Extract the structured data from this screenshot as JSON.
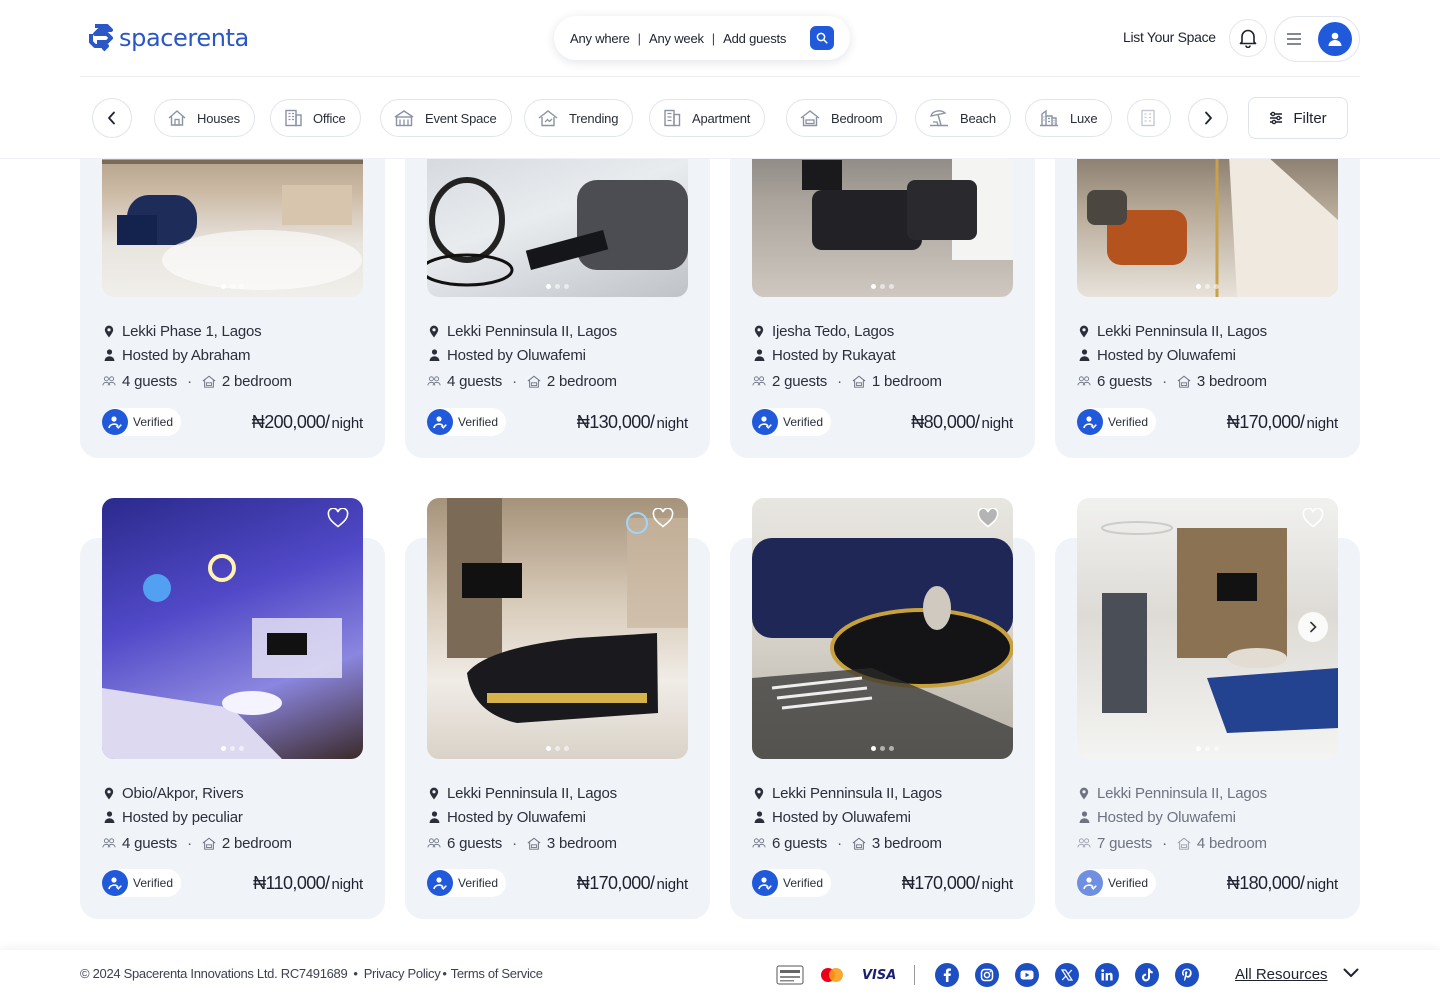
{
  "brand": {
    "name": "spacerenta",
    "color": "#2a56c6"
  },
  "search": {
    "where": "Any where",
    "when": "Any week",
    "who": "Add guests",
    "separator": "|"
  },
  "header": {
    "list_space": "List Your Space"
  },
  "categories": [
    {
      "label": "Houses",
      "icon": "house-icon"
    },
    {
      "label": "Office",
      "icon": "office-icon"
    },
    {
      "label": "Event Space",
      "icon": "event-space-icon"
    },
    {
      "label": "Trending",
      "icon": "trending-icon"
    },
    {
      "label": "Apartment",
      "icon": "apartment-icon"
    },
    {
      "label": "Bedroom",
      "icon": "bedroom-icon"
    },
    {
      "label": "Beach",
      "icon": "beach-icon"
    },
    {
      "label": "Luxe",
      "icon": "luxe-icon"
    }
  ],
  "filter": {
    "label": "Filter"
  },
  "listings": [
    {
      "location": "Lekki Phase 1, Lagos",
      "host": "Hosted by Abraham",
      "guests": "4 guests",
      "bedrooms": "2 bedroom",
      "verified": "Verified",
      "price": "₦200,000/",
      "unit": "night"
    },
    {
      "location": "Lekki Penninsula II, Lagos",
      "host": "Hosted by Oluwafemi",
      "guests": "4 guests",
      "bedrooms": "2 bedroom",
      "verified": "Verified",
      "price": "₦130,000/",
      "unit": "night"
    },
    {
      "location": "Ijesha Tedo, Lagos",
      "host": "Hosted by Rukayat",
      "guests": "2 guests",
      "bedrooms": "1 bedroom",
      "verified": "Verified",
      "price": "₦80,000/",
      "unit": "night"
    },
    {
      "location": "Lekki Penninsula II, Lagos",
      "host": "Hosted by Oluwafemi",
      "guests": "6 guests",
      "bedrooms": "3 bedroom",
      "verified": "Verified",
      "price": "₦170,000/",
      "unit": "night"
    },
    {
      "location": "Obio/Akpor, Rivers",
      "host": "Hosted by peculiar",
      "guests": "4 guests",
      "bedrooms": "2 bedroom",
      "verified": "Verified",
      "price": "₦110,000/",
      "unit": "night"
    },
    {
      "location": "Lekki Penninsula II, Lagos",
      "host": "Hosted by Oluwafemi",
      "guests": "6 guests",
      "bedrooms": "3 bedroom",
      "verified": "Verified",
      "price": "₦170,000/",
      "unit": "night"
    },
    {
      "location": "Lekki Penninsula II, Lagos",
      "host": "Hosted by Oluwafemi",
      "guests": "6 guests",
      "bedrooms": "3 bedroom",
      "verified": "Verified",
      "price": "₦170,000/",
      "unit": "night"
    },
    {
      "location": "Lekki Penninsula II, Lagos",
      "host": "Hosted by Oluwafemi",
      "guests": "7 guests",
      "bedrooms": "4 bedroom",
      "verified": "Verified",
      "price": "₦180,000/",
      "unit": "night"
    }
  ],
  "footer": {
    "copyright": "© 2024 Spacerenta Innovations Ltd. RC7491689",
    "bullet": "•",
    "privacy": "Privacy Policy",
    "terms": "Terms of Service",
    "visa": "VISA",
    "all_resources": "All Resources",
    "social": [
      "facebook-icon",
      "instagram-icon",
      "youtube-icon",
      "x-icon",
      "linkedin-icon",
      "tiktok-icon",
      "pinterest-icon"
    ]
  },
  "colors": {
    "accent": "#2059d9",
    "card_bg": "#f0f3f7",
    "social": "#1d4fc2"
  }
}
